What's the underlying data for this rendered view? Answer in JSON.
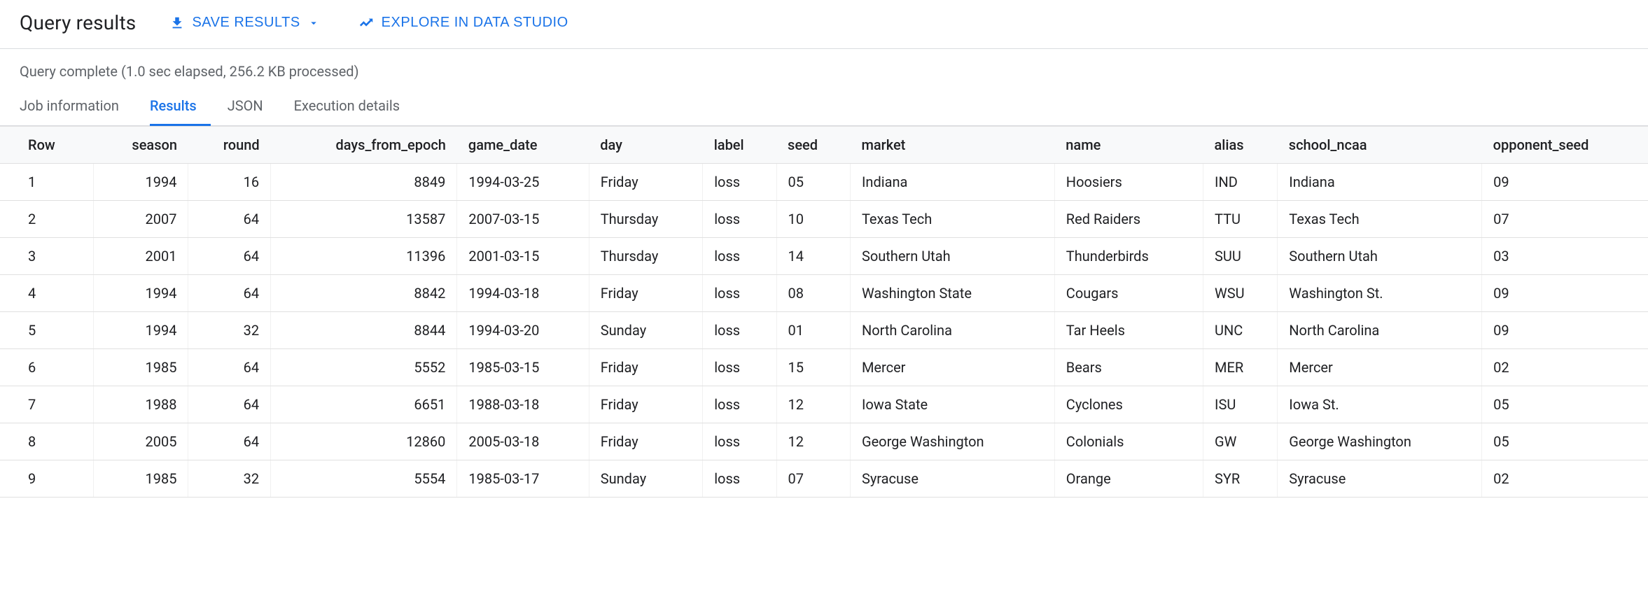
{
  "header": {
    "title": "Query results",
    "save_results_label": "SAVE RESULTS",
    "explore_label": "EXPLORE IN DATA STUDIO"
  },
  "status": "Query complete (1.0 sec elapsed, 256.2 KB processed)",
  "tabs": [
    {
      "label": "Job information",
      "active": false
    },
    {
      "label": "Results",
      "active": true
    },
    {
      "label": "JSON",
      "active": false
    },
    {
      "label": "Execution details",
      "active": false
    }
  ],
  "table": {
    "columns": [
      {
        "key": "row",
        "label": "Row",
        "align": "left"
      },
      {
        "key": "season",
        "label": "season",
        "align": "right"
      },
      {
        "key": "round",
        "label": "round",
        "align": "right"
      },
      {
        "key": "days_from_epoch",
        "label": "days_from_epoch",
        "align": "right"
      },
      {
        "key": "game_date",
        "label": "game_date",
        "align": "left"
      },
      {
        "key": "day",
        "label": "day",
        "align": "left"
      },
      {
        "key": "label",
        "label": "label",
        "align": "left"
      },
      {
        "key": "seed",
        "label": "seed",
        "align": "left"
      },
      {
        "key": "market",
        "label": "market",
        "align": "left"
      },
      {
        "key": "name",
        "label": "name",
        "align": "left"
      },
      {
        "key": "alias",
        "label": "alias",
        "align": "left"
      },
      {
        "key": "school_ncaa",
        "label": "school_ncaa",
        "align": "left"
      },
      {
        "key": "opponent_seed",
        "label": "opponent_seed",
        "align": "left"
      }
    ],
    "rows": [
      {
        "row": "1",
        "season": "1994",
        "round": "16",
        "days_from_epoch": "8849",
        "game_date": "1994-03-25",
        "day": "Friday",
        "label": "loss",
        "seed": "05",
        "market": "Indiana",
        "name": "Hoosiers",
        "alias": "IND",
        "school_ncaa": "Indiana",
        "opponent_seed": "09"
      },
      {
        "row": "2",
        "season": "2007",
        "round": "64",
        "days_from_epoch": "13587",
        "game_date": "2007-03-15",
        "day": "Thursday",
        "label": "loss",
        "seed": "10",
        "market": "Texas Tech",
        "name": "Red Raiders",
        "alias": "TTU",
        "school_ncaa": "Texas Tech",
        "opponent_seed": "07"
      },
      {
        "row": "3",
        "season": "2001",
        "round": "64",
        "days_from_epoch": "11396",
        "game_date": "2001-03-15",
        "day": "Thursday",
        "label": "loss",
        "seed": "14",
        "market": "Southern Utah",
        "name": "Thunderbirds",
        "alias": "SUU",
        "school_ncaa": "Southern Utah",
        "opponent_seed": "03"
      },
      {
        "row": "4",
        "season": "1994",
        "round": "64",
        "days_from_epoch": "8842",
        "game_date": "1994-03-18",
        "day": "Friday",
        "label": "loss",
        "seed": "08",
        "market": "Washington State",
        "name": "Cougars",
        "alias": "WSU",
        "school_ncaa": "Washington St.",
        "opponent_seed": "09"
      },
      {
        "row": "5",
        "season": "1994",
        "round": "32",
        "days_from_epoch": "8844",
        "game_date": "1994-03-20",
        "day": "Sunday",
        "label": "loss",
        "seed": "01",
        "market": "North Carolina",
        "name": "Tar Heels",
        "alias": "UNC",
        "school_ncaa": "North Carolina",
        "opponent_seed": "09"
      },
      {
        "row": "6",
        "season": "1985",
        "round": "64",
        "days_from_epoch": "5552",
        "game_date": "1985-03-15",
        "day": "Friday",
        "label": "loss",
        "seed": "15",
        "market": "Mercer",
        "name": "Bears",
        "alias": "MER",
        "school_ncaa": "Mercer",
        "opponent_seed": "02"
      },
      {
        "row": "7",
        "season": "1988",
        "round": "64",
        "days_from_epoch": "6651",
        "game_date": "1988-03-18",
        "day": "Friday",
        "label": "loss",
        "seed": "12",
        "market": "Iowa State",
        "name": "Cyclones",
        "alias": "ISU",
        "school_ncaa": "Iowa St.",
        "opponent_seed": "05"
      },
      {
        "row": "8",
        "season": "2005",
        "round": "64",
        "days_from_epoch": "12860",
        "game_date": "2005-03-18",
        "day": "Friday",
        "label": "loss",
        "seed": "12",
        "market": "George Washington",
        "name": "Colonials",
        "alias": "GW",
        "school_ncaa": "George Washington",
        "opponent_seed": "05"
      },
      {
        "row": "9",
        "season": "1985",
        "round": "32",
        "days_from_epoch": "5554",
        "game_date": "1985-03-17",
        "day": "Sunday",
        "label": "loss",
        "seed": "07",
        "market": "Syracuse",
        "name": "Orange",
        "alias": "SYR",
        "school_ncaa": "Syracuse",
        "opponent_seed": "02"
      }
    ]
  }
}
